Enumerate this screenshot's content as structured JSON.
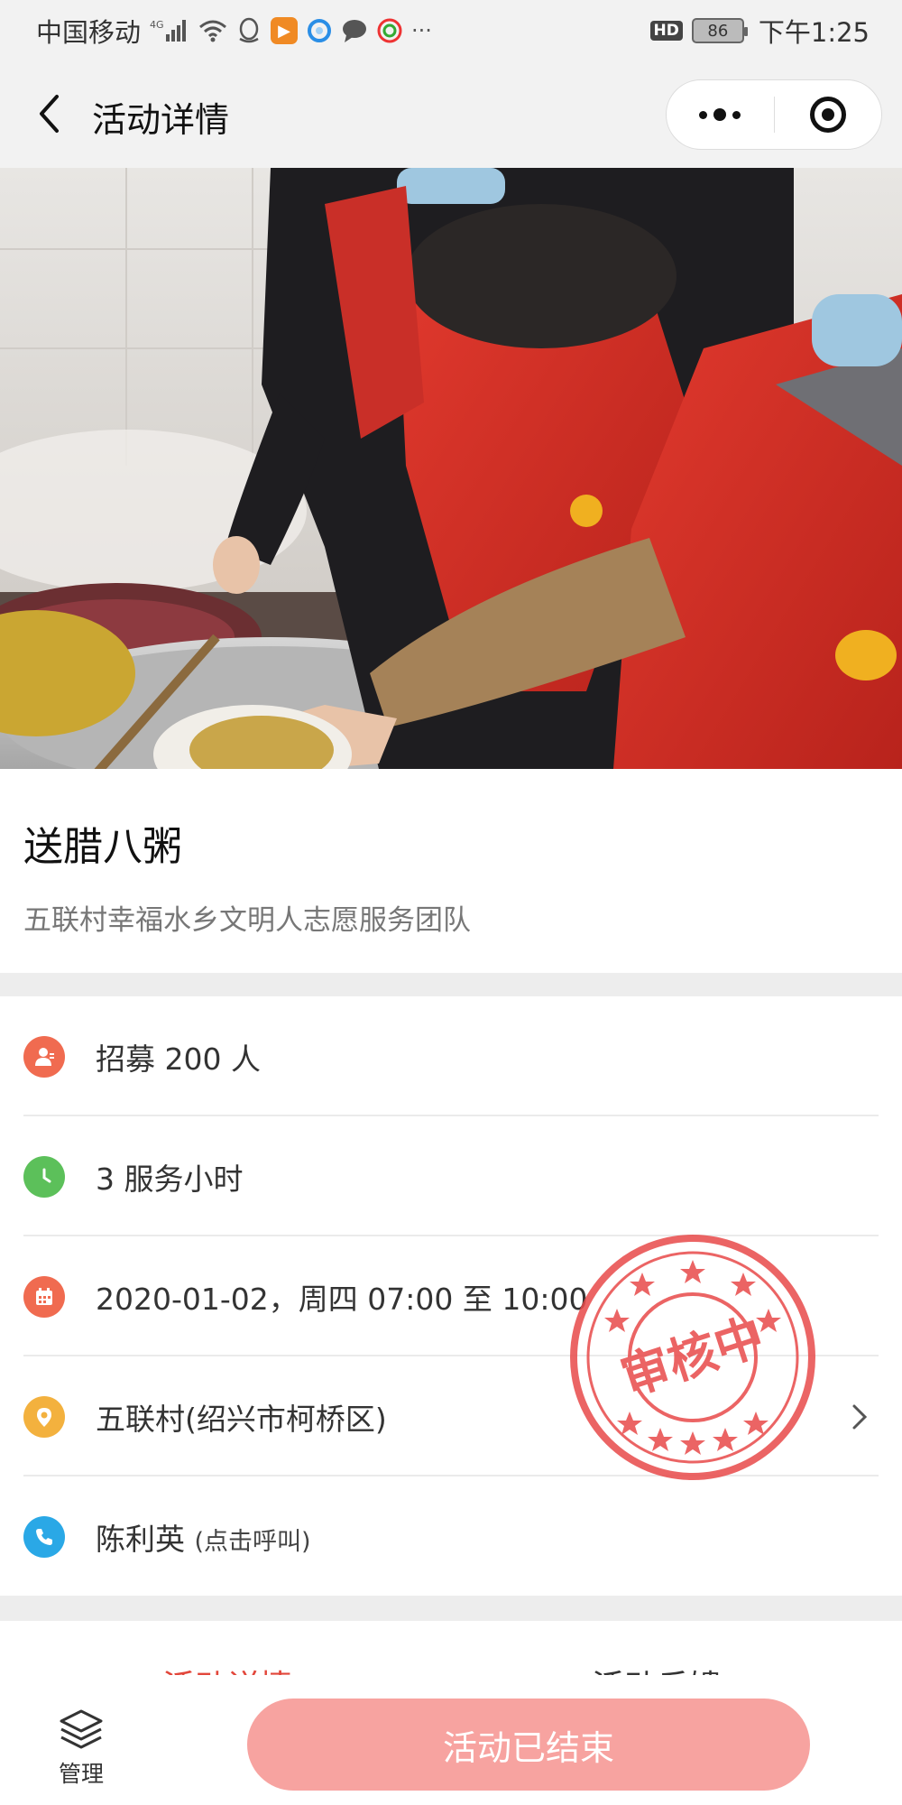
{
  "status_bar": {
    "carrier": "中国移动",
    "network": "4G",
    "hd": "HD",
    "battery": "86",
    "time": "下午1:25",
    "more": "···"
  },
  "nav": {
    "title": "活动详情"
  },
  "activity": {
    "title": "送腊八粥",
    "team": "五联村幸福水乡文明人志愿服务团队"
  },
  "info": {
    "recruit": "招募 200 人",
    "hours": "3 服务小时",
    "datetime": "2020-01-02，周四 07:00 至 10:00",
    "location": "五联村(绍兴市柯桥区)",
    "contact_name": "陈利英",
    "contact_hint": "(点击呼叫)"
  },
  "stamp": {
    "text": "审核中"
  },
  "tabs": [
    {
      "label": "活动详情",
      "active": true
    },
    {
      "label": "活动反馈",
      "active": false
    }
  ],
  "bottom": {
    "manage_label": "管理",
    "action_label": "活动已结束"
  },
  "colors": {
    "accent": "#e2463a",
    "button": "#f7a3a0",
    "icon_person": "#f06b50",
    "icon_clock": "#5cc05a",
    "icon_calendar": "#f06b50",
    "icon_location": "#f3b13e",
    "icon_phone": "#2aa8e6",
    "stamp": "#e84a4a"
  }
}
